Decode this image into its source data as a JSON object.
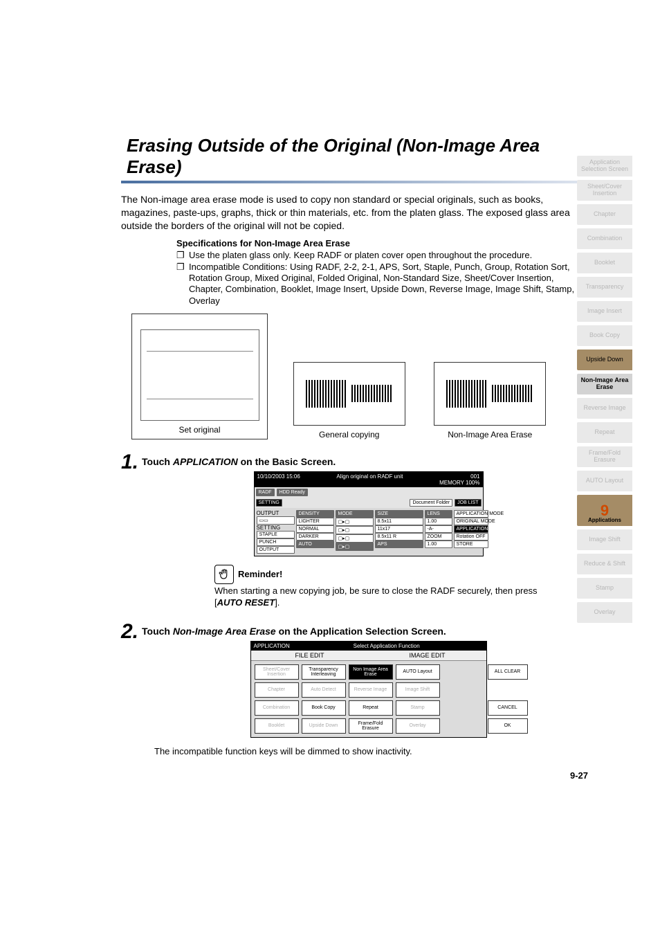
{
  "title": "Erasing Outside of the Original (Non-Image Area Erase)",
  "intro": "The Non-image area erase mode is used to copy non standard or special originals, such as books, magazines, paste-ups, graphs, thick or thin materials, etc. from the platen glass. The exposed glass area outside the borders of the original will not be copied.",
  "specs_heading": "Specifications for Non-Image Area Erase",
  "bullets": [
    "Use the platen glass only. Keep RADF or platen cover open throughout the procedure.",
    "Incompatible Conditions: Using RADF, 2-2, 2-1, APS, Sort, Staple, Punch, Group, Rotation Sort, Rotation Group, Mixed Original, Folded Original, Non-Standard Size, Sheet/Cover Insertion, Chapter, Combination, Booklet, Image Insert, Upside Down, Reverse Image, Image Shift, Stamp, Overlay"
  ],
  "diagram": {
    "set_original": "Set original",
    "general": "General copying",
    "erase": "Non-Image Area Erase"
  },
  "steps": {
    "s1": {
      "num": "1.",
      "pre": "Touch ",
      "bold": "APPLICATION",
      "post": " on the Basic Screen."
    },
    "s2": {
      "num": "2.",
      "pre": "Touch ",
      "bold": "Non-Image Area Erase",
      "post": " on the Application Selection Screen."
    }
  },
  "basic_screen": {
    "time": "10/10/2003 15:06",
    "msg": "Align original on RADF unit",
    "counter": "001",
    "memory": "MEMORY 100%",
    "radf": "RADF",
    "hdd": "HDD Ready",
    "setting": "SETTING",
    "docfolder": "Document Folder",
    "joblist": "JOB LIST",
    "output": "OUTPUT",
    "setting2": "SETTING",
    "staple": "STAPLE",
    "punch": "PUNCH",
    "output2": "OUTPUT",
    "density": "DENSITY",
    "lighter": "LIGHTER",
    "normal": "NORMAL",
    "darker": "DARKER",
    "auto": "AUTO",
    "mode": "MODE",
    "size": "SIZE",
    "aps": "APS",
    "sizes": [
      "8.5x11",
      "11x17",
      "8.5x11 R",
      "8.5x11"
    ],
    "qty": "1",
    "lens": "LENS",
    "lens_val": "1.00",
    "dash": "-A-",
    "zoom": "ZOOM",
    "zoom_val": "1.00",
    "appmode": "APPLICATION MODE",
    "origmode": "ORIGINAL MODE",
    "application": "APPLICATION",
    "rotationoff": "Rotation OFF",
    "store": "STORE"
  },
  "reminder": {
    "label": "Reminder",
    "text_a": "When starting a new copying job, be sure to close the RADF securely, then press [",
    "text_b": "AUTO RESET",
    "text_c": "]."
  },
  "app_screen": {
    "head_l": "APPLICATION",
    "head_c": "Select Application Function",
    "file_edit": "FILE EDIT",
    "image_edit": "IMAGE EDIT",
    "buttons": {
      "sheet_cover": "Sheet/Cover Insertion",
      "transparency": "Transparency Interleaving",
      "non_image": "Non Image Area Erase",
      "auto_layout": "AUTO Layout",
      "chapter": "Chapter",
      "auto_detect": "Auto Detect",
      "reverse": "Reverse Image",
      "image_shift": "Image Shift",
      "combination": "Combination",
      "book_copy": "Book Copy",
      "repeat": "Repeat",
      "stamp": "Stamp",
      "booklet": "Booklet",
      "upside_down": "Upside Down",
      "frame_fold": "Frame/Fold Erasure",
      "overlay": "Overlay",
      "all_clear": "ALL CLEAR",
      "cancel": "CANCEL",
      "ok": "OK"
    }
  },
  "after_text": "The incompatible function keys will be dimmed to show inactivity.",
  "page_num": "9-27",
  "sidebar": [
    {
      "label": "Application Selection Screen",
      "cls": ""
    },
    {
      "label": "Sheet/Cover Insertion",
      "cls": ""
    },
    {
      "label": "Chapter",
      "cls": ""
    },
    {
      "label": "Combination",
      "cls": ""
    },
    {
      "label": "Booklet",
      "cls": ""
    },
    {
      "label": "Transparency",
      "cls": ""
    },
    {
      "label": "Image Insert",
      "cls": ""
    },
    {
      "label": "Book Copy",
      "cls": ""
    },
    {
      "label": "Upside Down",
      "cls": "dark"
    },
    {
      "label": "Non-Image Area Erase",
      "cls": "strong"
    },
    {
      "label": "Reverse Image",
      "cls": ""
    },
    {
      "label": "Repeat",
      "cls": ""
    },
    {
      "label": "Frame/Fold Erasure",
      "cls": ""
    },
    {
      "label": "AUTO Layout",
      "cls": ""
    }
  ],
  "sidebar_chapter": {
    "num": "9",
    "label": "Applications"
  },
  "sidebar_after": [
    {
      "label": "Image Shift",
      "cls": ""
    },
    {
      "label": "Reduce & Shift",
      "cls": ""
    },
    {
      "label": "Stamp",
      "cls": ""
    },
    {
      "label": "Overlay",
      "cls": ""
    }
  ]
}
